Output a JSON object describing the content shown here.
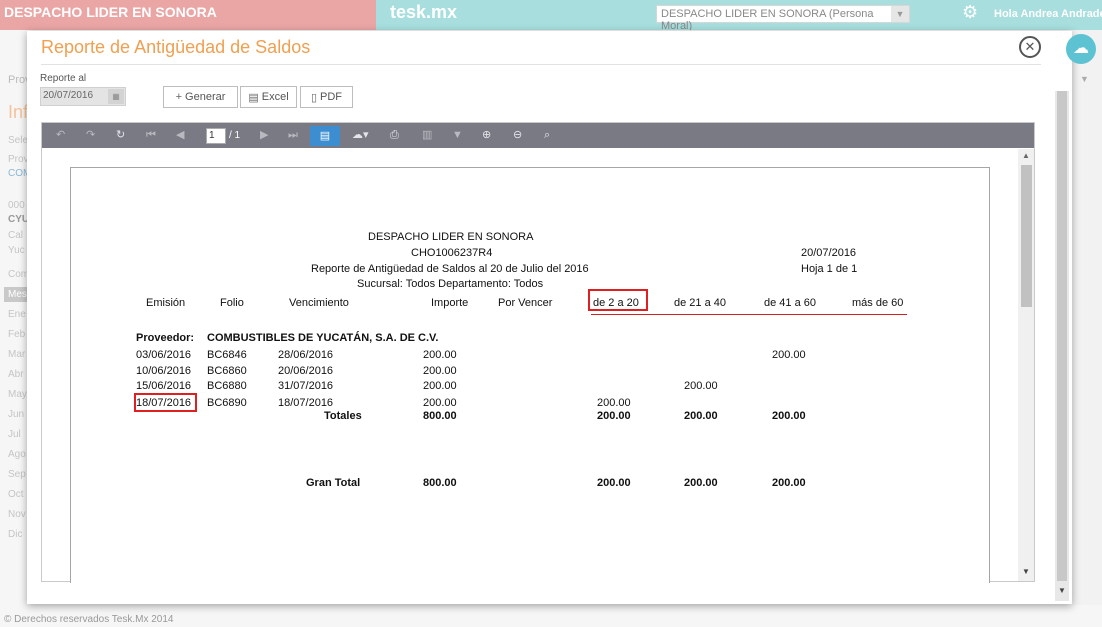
{
  "topbar": {
    "company_name": "DESPACHO LIDER EN SONORA",
    "brand": "tesk.mx",
    "company_select": "DESPACHO LIDER EN SONORA (Persona Moral)",
    "greeting": "Hola Andrea Andrade",
    "icons": {
      "settings": "gear-icon",
      "cloud": "cloud-icon"
    }
  },
  "background": {
    "left_labels": [
      "Prov",
      "Inf",
      "Selec",
      "Prove",
      "COM",
      "000",
      "CYU",
      "Cal",
      "Yuc",
      "Comp",
      "Mes",
      "Ene",
      "Feb",
      "Mar",
      "Abr",
      "May",
      "Jun",
      "Jul",
      "Ago",
      "Sep",
      "Oct",
      "Nov",
      "Dic"
    ],
    "footer": "© Derechos reservados Tesk.Mx 2014"
  },
  "modal": {
    "title": "Reporte de Antigüedad de Saldos",
    "date_label": "Reporte al",
    "date_value": "20/07/2016",
    "buttons": {
      "generar": "Generar",
      "excel": "Excel",
      "pdf": "PDF"
    }
  },
  "viewer": {
    "current_page": "1",
    "total_pages": "/ 1"
  },
  "report": {
    "company": "DESPACHO LIDER EN SONORA",
    "rfc": "CHO1006237R4",
    "date": "20/07/2016",
    "title": "Reporte de Antigüedad de Saldos al 20 de Julio del 2016",
    "page": "Hoja 1 de 1",
    "filters": "Sucursal: Todos Departamento: Todos",
    "columns": [
      "Emisión",
      "Folio",
      "Vencimiento",
      "Importe",
      "Por Vencer",
      "de 2 a 20",
      "de 21 a 40",
      "de 41 a 60",
      "más de 60"
    ],
    "provider_label": "Proveedor:",
    "provider_name": "COMBUSTIBLES DE YUCATÁN, S.A. DE C.V.",
    "rows": [
      {
        "emision": "03/06/2016",
        "folio": "BC6846",
        "vencimiento": "28/06/2016",
        "importe": "200.00",
        "c2_20": "",
        "c21_40": "",
        "c41_60": "200.00"
      },
      {
        "emision": "10/06/2016",
        "folio": "BC6860",
        "vencimiento": "20/06/2016",
        "importe": "200.00",
        "c2_20": "",
        "c21_40": "",
        "c41_60": ""
      },
      {
        "emision": "15/06/2016",
        "folio": "BC6880",
        "vencimiento": "31/07/2016",
        "importe": "200.00",
        "c2_20": "",
        "c21_40": "200.00",
        "c41_60": ""
      },
      {
        "emision": "18/07/2016",
        "folio": "BC6890",
        "vencimiento": "18/07/2016",
        "importe": "200.00",
        "c2_20": "200.00",
        "c21_40": "",
        "c41_60": ""
      }
    ],
    "totals_label": "Totales",
    "totals": {
      "importe": "800.00",
      "c2_20": "200.00",
      "c21_40": "200.00",
      "c41_60": "200.00"
    },
    "grand_label": "Gran Total",
    "grand": {
      "importe": "800.00",
      "c2_20": "200.00",
      "c21_40": "200.00",
      "c41_60": "200.00"
    }
  }
}
